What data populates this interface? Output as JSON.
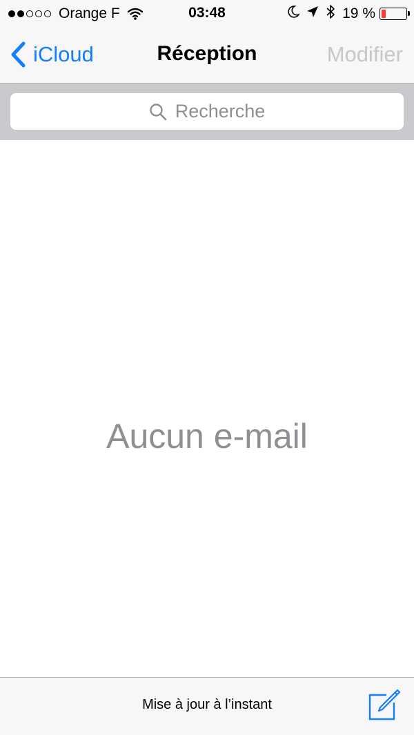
{
  "status_bar": {
    "signal_filled": 2,
    "signal_total": 5,
    "carrier": "Orange F",
    "time": "03:48",
    "battery_percent": "19 %",
    "battery_level": 0.19,
    "icons": [
      "wifi-icon",
      "moon-icon",
      "location-arrow-icon",
      "bluetooth-icon",
      "battery-icon"
    ],
    "battery_color": "#ff3b30"
  },
  "nav": {
    "back_label": "iCloud",
    "title": "Réception",
    "edit_label": "Modifier",
    "accent_color": "#157efb",
    "disabled_color": "#c7c7cc"
  },
  "search": {
    "placeholder": "Recherche"
  },
  "content": {
    "empty_message": "Aucun e-mail"
  },
  "toolbar": {
    "status": "Mise à jour à l’instant",
    "compose_icon": "compose-icon"
  }
}
